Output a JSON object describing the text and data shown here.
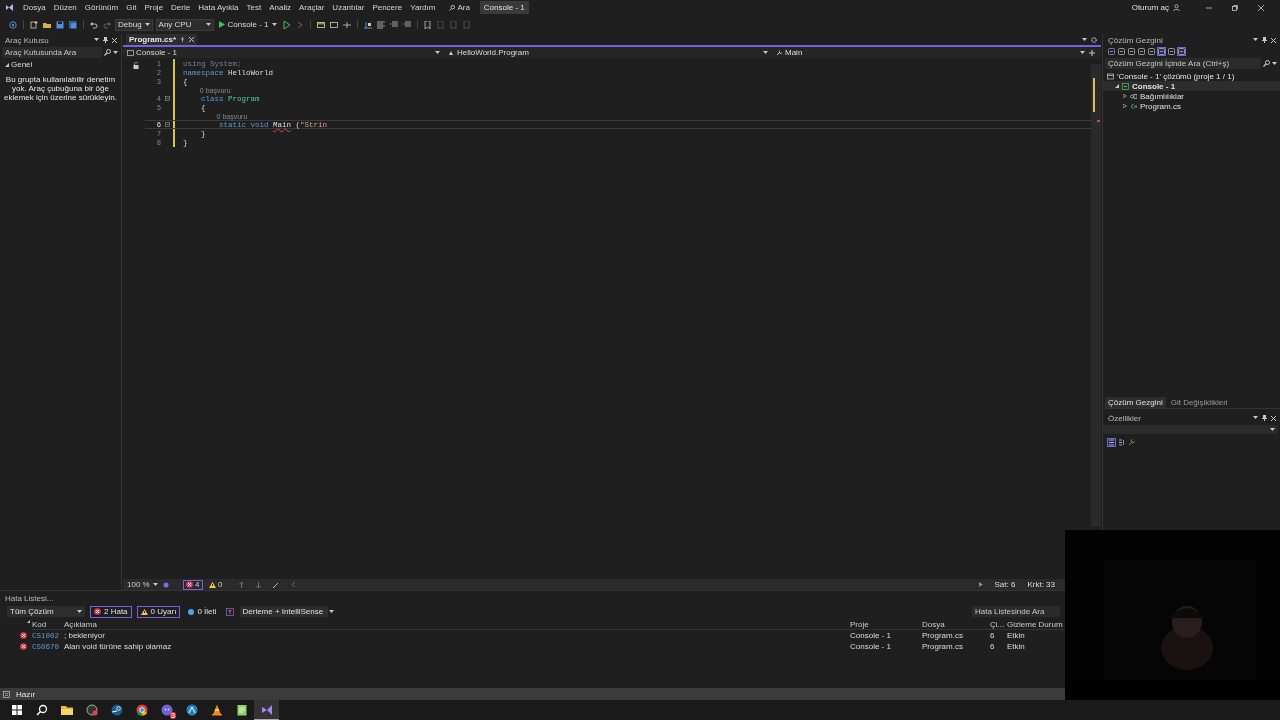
{
  "menu": {
    "items": [
      "Dosya",
      "Düzen",
      "Görünüm",
      "Git",
      "Proje",
      "Derle",
      "Hata Ayıkla",
      "Test",
      "Analiz",
      "Araçlar",
      "Uzantılar",
      "Pencere",
      "Yardım"
    ],
    "search": "Ara",
    "solution_name": "Console - 1",
    "sign_in": "Oturum aç"
  },
  "toolbar": {
    "configuration": "Debug",
    "platform": "Any CPU",
    "start": "Console - 1"
  },
  "toolbox": {
    "title": "Araç Kutusu",
    "search_placeholder": "Araç Kutusunda Ara",
    "group": {
      "label": "Genel",
      "expanded": true
    },
    "empty_message": "Bu grupta kullanılabilir denetim yok. Araç çubuğuna bir öğe eklemek için üzerine sürükleyin."
  },
  "editor": {
    "tabs": [
      {
        "label": "Program.cs*",
        "selected": true
      }
    ],
    "nav": {
      "project": "Console - 1",
      "type": "HelloWorld.Program",
      "member": "Main"
    },
    "lines": [
      {
        "number": "1",
        "current": false,
        "foldable": false,
        "tokens": [
          {
            "text": "using System;",
            "kind": "unused"
          }
        ]
      },
      {
        "number": "2",
        "current": false,
        "foldable": false,
        "tokens": [
          {
            "text": "namespace",
            "kind": "keyword"
          },
          {
            "text": " HelloWorld",
            "kind": "plain"
          }
        ]
      },
      {
        "number": "3",
        "current": false,
        "foldable": false,
        "tokens": [
          {
            "text": "{",
            "kind": "plain"
          }
        ]
      },
      {
        "number": "4",
        "current": false,
        "foldable": true,
        "codelens": "0 başvuru",
        "tokens": [
          {
            "text": "    class",
            "kind": "keyword"
          },
          {
            "text": " Program",
            "kind": "type"
          }
        ]
      },
      {
        "number": "5",
        "current": false,
        "foldable": false,
        "tokens": [
          {
            "text": "    {",
            "kind": "plain"
          }
        ]
      },
      {
        "number": "6",
        "current": true,
        "foldable": true,
        "codelens": "0 başvuru",
        "tokens": [
          {
            "text": "        static void ",
            "kind": "keyword"
          },
          {
            "text": "Main",
            "kind": "invalid"
          },
          {
            "text": " (",
            "kind": "plain"
          },
          {
            "text": "\"Strin",
            "kind": "string"
          }
        ]
      },
      {
        "number": "7",
        "current": false,
        "foldable": false,
        "tokens": [
          {
            "text": "    }",
            "kind": "plain"
          }
        ]
      },
      {
        "number": "8",
        "current": false,
        "foldable": false,
        "tokens": [
          {
            "text": "}",
            "kind": "plain"
          }
        ]
      }
    ],
    "zoom": "100 %",
    "errors": "4",
    "warnings": "0",
    "line": "Sat: 6",
    "column": "Krkt: 33"
  },
  "solution_explorer": {
    "title": "Çözüm Gezgini",
    "search_placeholder": "Çözüm Gezgini İçinde Ara (Ctrl+ş)",
    "tree": [
      {
        "label": "'Console - 1' çözümü (proje 1 / 1)",
        "kind": "solution",
        "selected": false,
        "children": [
          {
            "label": "Console - 1",
            "kind": "project",
            "selected": true,
            "expanded": true,
            "children": [
              {
                "label": "Bağımlılıklar",
                "kind": "dependencies",
                "selected": false,
                "expanded": false
              },
              {
                "label": "Program.cs",
                "kind": "csharp",
                "selected": false,
                "expanded": false
              }
            ]
          }
        ]
      }
    ]
  },
  "right_tabs": [
    {
      "label": "Çözüm Gezgini",
      "selected": true
    },
    {
      "label": "Git Değişiklikleri",
      "selected": false
    }
  ],
  "properties": {
    "title": "Özellikler"
  },
  "error_list": {
    "title": "Hata Listesi...",
    "scope": "Tüm Çözüm",
    "filters": [
      {
        "label": "2 Hata",
        "kind": "error",
        "on": true
      },
      {
        "label": "0 Uyarı",
        "kind": "warning",
        "on": true
      },
      {
        "label": "0 İleti",
        "kind": "info",
        "on": false
      }
    ],
    "source": "Derleme + IntelliSense",
    "search_placeholder": "Hata Listesinde Ara",
    "columns": [
      "Kod",
      "Açıklama",
      "Proje",
      "Dosya",
      "Çi...",
      "Gizleme Durum"
    ],
    "rows": [
      {
        "code": "CS1002",
        "description": "; bekleniyor",
        "project": "Console - 1",
        "file": "Program.cs",
        "line": "6",
        "state": "Etkin"
      },
      {
        "code": "CS0670",
        "description": "Alan void türüne sahip olamaz",
        "project": "Console - 1",
        "file": "Program.cs",
        "line": "6",
        "state": "Etkin"
      }
    ]
  },
  "status_bar": {
    "text": "Hazır"
  },
  "taskbar": {
    "apps": [
      {
        "kind": "start",
        "selected": false
      },
      {
        "kind": "search",
        "selected": false
      },
      {
        "kind": "folder",
        "selected": false
      },
      {
        "kind": "recorder",
        "selected": false
      },
      {
        "kind": "steam",
        "selected": false
      },
      {
        "kind": "chrome",
        "selected": false
      },
      {
        "kind": "chat",
        "selected": false,
        "badge": "3"
      },
      {
        "kind": "app",
        "selected": false
      },
      {
        "kind": "cone",
        "selected": false
      },
      {
        "kind": "notes",
        "selected": false
      },
      {
        "kind": "vs",
        "selected": true
      }
    ]
  }
}
